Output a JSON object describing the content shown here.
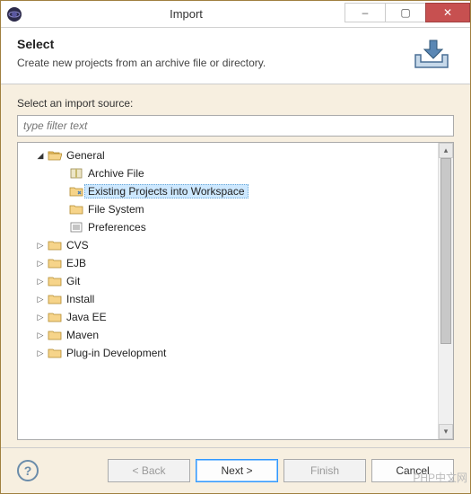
{
  "window": {
    "title": "Import"
  },
  "titlebar_controls": {
    "minimize": "–",
    "maximize": "▢",
    "close": "✕"
  },
  "header": {
    "heading": "Select",
    "description": "Create new projects from an archive file or directory."
  },
  "body": {
    "source_label": "Select an import source:",
    "filter_placeholder": "type filter text"
  },
  "tree": {
    "items": [
      {
        "label": "General",
        "depth": 1,
        "expander": "open",
        "icon": "folder-open",
        "selected": false
      },
      {
        "label": "Archive File",
        "depth": 2,
        "expander": "none",
        "icon": "archive",
        "selected": false
      },
      {
        "label": "Existing Projects into Workspace",
        "depth": 2,
        "expander": "none",
        "icon": "project",
        "selected": true
      },
      {
        "label": "File System",
        "depth": 2,
        "expander": "none",
        "icon": "folder",
        "selected": false
      },
      {
        "label": "Preferences",
        "depth": 2,
        "expander": "none",
        "icon": "prefs",
        "selected": false
      },
      {
        "label": "CVS",
        "depth": 1,
        "expander": "closed",
        "icon": "folder",
        "selected": false
      },
      {
        "label": "EJB",
        "depth": 1,
        "expander": "closed",
        "icon": "folder",
        "selected": false
      },
      {
        "label": "Git",
        "depth": 1,
        "expander": "closed",
        "icon": "folder",
        "selected": false
      },
      {
        "label": "Install",
        "depth": 1,
        "expander": "closed",
        "icon": "folder",
        "selected": false
      },
      {
        "label": "Java EE",
        "depth": 1,
        "expander": "closed",
        "icon": "folder",
        "selected": false
      },
      {
        "label": "Maven",
        "depth": 1,
        "expander": "closed",
        "icon": "folder",
        "selected": false
      },
      {
        "label": "Plug-in Development",
        "depth": 1,
        "expander": "closed",
        "icon": "folder",
        "selected": false
      }
    ]
  },
  "footer": {
    "help_tooltip": "?",
    "back": "< Back",
    "next": "Next >",
    "finish": "Finish",
    "cancel": "Cancel"
  },
  "buttons_state": {
    "back_enabled": false,
    "next_enabled": true,
    "finish_enabled": false,
    "cancel_enabled": true
  },
  "watermark": "PHP中文网"
}
